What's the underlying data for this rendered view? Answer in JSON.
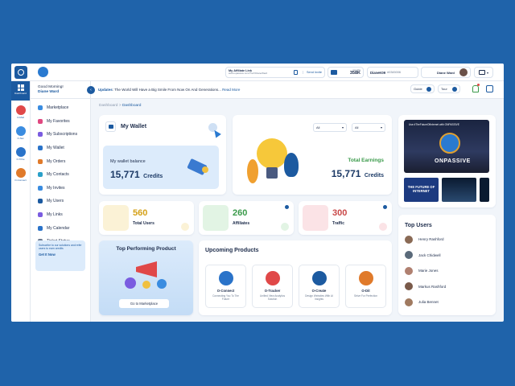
{
  "header": {
    "affiliate_title": "My Affiliate Link",
    "affiliate_url": "www.opassive.com/?ref=DianeWard",
    "send_invite": "Send Invite",
    "credits_label": "Credits",
    "credits_value": "358K",
    "username": "DianeK09",
    "user_id": "#0345006",
    "profile_name": "Diane Ward"
  },
  "rail": [
    {
      "label": "Dashboard",
      "color": "#1c5aa0"
    },
    {
      "label": "O-Mail",
      "color": "#e04848"
    },
    {
      "label": "O-Net",
      "color": "#3a8ce0"
    },
    {
      "label": "O-Tribe",
      "color": "#2a73c9"
    },
    {
      "label": "O-Connect",
      "color": "#e07a2a"
    }
  ],
  "sidebar": {
    "greeting": "Good Morning!",
    "name": "Diane Ward",
    "items": [
      {
        "label": "Marketplace",
        "color": "#3a8ce0"
      },
      {
        "label": "My Favorites",
        "color": "#e04880"
      },
      {
        "label": "My Subscriptions",
        "color": "#7a5ce0"
      },
      {
        "label": "My Wallet",
        "color": "#2a73c9"
      },
      {
        "label": "My Orders",
        "color": "#e07a2a"
      },
      {
        "label": "My Contacts",
        "color": "#2aa0c9"
      },
      {
        "label": "My Invites",
        "color": "#3a8ce0"
      },
      {
        "label": "My Users",
        "color": "#1c5aa0"
      },
      {
        "label": "My Links",
        "color": "#7a5ce0"
      },
      {
        "label": "My Calendar",
        "color": "#2a73c9"
      },
      {
        "label": "Ticket Status",
        "color": "#6b7a90"
      }
    ],
    "refer_text": "Subscribe to our solutions and refer users to earn credits",
    "refer_cta": "Get It Now"
  },
  "updates": {
    "label": "Updates",
    "text": ": The World Will Have a Big Smile From Now On And Generations...",
    "read_more": "Read More",
    "guide": "Guide",
    "tour": "Tour"
  },
  "breadcrumb": {
    "root": "Dashboard",
    "current": "Dashboard"
  },
  "wallet": {
    "title": "My Wallet",
    "balance_label": "My wallet balance",
    "balance_value": "15,771",
    "balance_unit": "Credits",
    "filter1": "All",
    "filter2": "All",
    "earnings_label": "Total Earnings",
    "earnings_value": "15,771",
    "earnings_unit": "Credits"
  },
  "stats": [
    {
      "value": "560",
      "label": "Total Users",
      "color": "#d4a017",
      "bg": "#fbf2d6"
    },
    {
      "value": "260",
      "label": "Affiliates",
      "color": "#3a9a4a",
      "bg": "#e2f4e4"
    },
    {
      "value": "300",
      "label": "Traffic",
      "color": "#c94848",
      "bg": "#fbe3e6"
    }
  ],
  "top_product": {
    "title": "Top Performing Product",
    "cta": "Go to Marketplace"
  },
  "upcoming": {
    "title": "Upcoming Products",
    "items": [
      {
        "name": "O-Connect",
        "desc": "Connecting You To The Future",
        "color": "#2a73c9"
      },
      {
        "name": "O-Tracker",
        "desc": "Unified View Analytics Solution",
        "color": "#e04848"
      },
      {
        "name": "O-Create",
        "desc": "Design Websites With AI Insights",
        "color": "#1c5aa0"
      },
      {
        "name": "O-Dit",
        "desc": "Strive For Perfection",
        "color": "#e07a2a"
      }
    ]
  },
  "media": {
    "caption": "Use #TheFutureOfInternet with ONPASSIVE",
    "brand": "ONPASSIVE",
    "thumb1": "THE FUTURE OF INTERNET"
  },
  "top_users": {
    "title": "Top Users",
    "users": [
      {
        "name": "Henry Rashford",
        "color": "#8a6a55"
      },
      {
        "name": "Jack Chidwell",
        "color": "#5a6a7a"
      },
      {
        "name": "Marie Jones",
        "color": "#b08070"
      },
      {
        "name": "Markus Rashford",
        "color": "#7a5a4a"
      },
      {
        "name": "Julia Bennet",
        "color": "#a07a60"
      }
    ]
  }
}
